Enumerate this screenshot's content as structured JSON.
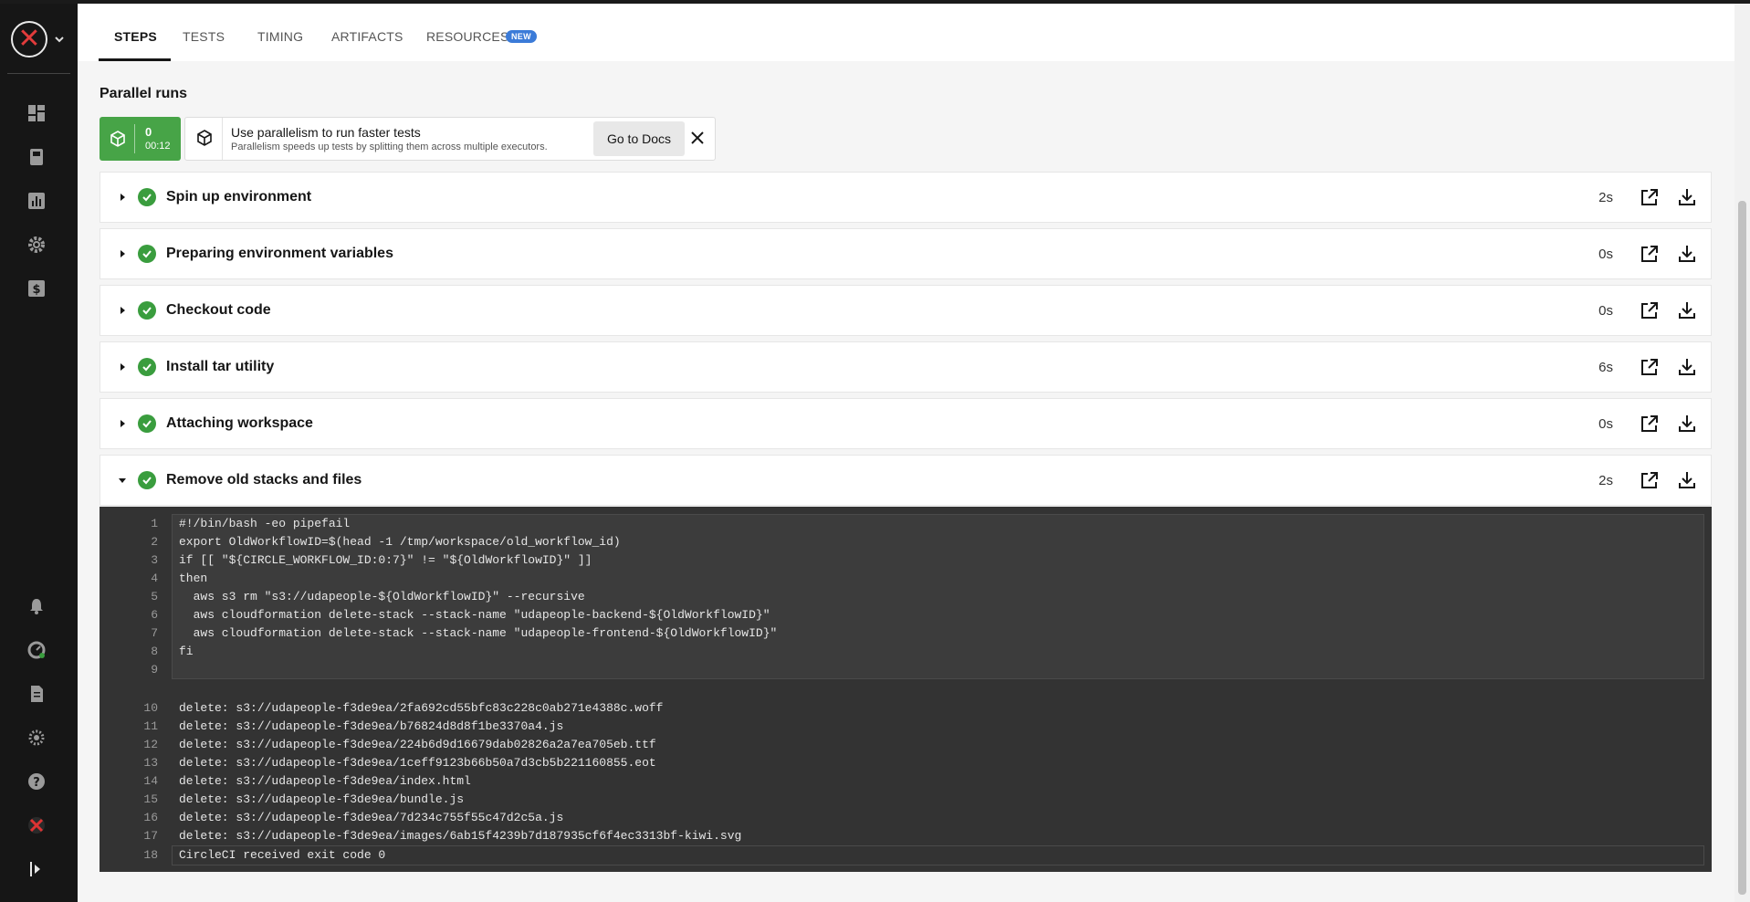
{
  "tabs": [
    {
      "label": "STEPS",
      "active": true
    },
    {
      "label": "TESTS",
      "active": false
    },
    {
      "label": "TIMING",
      "active": false
    },
    {
      "label": "ARTIFACTS",
      "active": false
    },
    {
      "label": "RESOURCES",
      "active": false
    }
  ],
  "resources_badge": "NEW",
  "parallel": {
    "title": "Parallel runs",
    "run_index": "0",
    "run_time": "00:12",
    "hint_title": "Use parallelism to run faster tests",
    "hint_subtitle": "Parallelism speeds up tests by splitting them across multiple executors.",
    "docs_button": "Go to Docs"
  },
  "steps": [
    {
      "name": "Spin up environment",
      "duration": "2s",
      "status": "success",
      "expanded": false
    },
    {
      "name": "Preparing environment variables",
      "duration": "0s",
      "status": "success",
      "expanded": false
    },
    {
      "name": "Checkout code",
      "duration": "0s",
      "status": "success",
      "expanded": false
    },
    {
      "name": "Install tar utility",
      "duration": "6s",
      "status": "success",
      "expanded": false
    },
    {
      "name": "Attaching workspace",
      "duration": "0s",
      "status": "success",
      "expanded": false
    },
    {
      "name": "Remove old stacks and files",
      "duration": "2s",
      "status": "success",
      "expanded": true
    }
  ],
  "terminal": {
    "command_lines": [
      {
        "n": "1",
        "text": "#!/bin/bash -eo pipefail"
      },
      {
        "n": "2",
        "text": "export OldWorkflowID=$(head -1 /tmp/workspace/old_workflow_id)"
      },
      {
        "n": "3",
        "text": "if [[ \"${CIRCLE_WORKFLOW_ID:0:7}\" != \"${OldWorkflowID}\" ]]"
      },
      {
        "n": "4",
        "text": "then"
      },
      {
        "n": "5",
        "text": "  aws s3 rm \"s3://udapeople-${OldWorkflowID}\" --recursive"
      },
      {
        "n": "6",
        "text": "  aws cloudformation delete-stack --stack-name \"udapeople-backend-${OldWorkflowID}\""
      },
      {
        "n": "7",
        "text": "  aws cloudformation delete-stack --stack-name \"udapeople-frontend-${OldWorkflowID}\""
      },
      {
        "n": "8",
        "text": "fi"
      },
      {
        "n": "9",
        "text": ""
      }
    ],
    "output_lines": [
      {
        "n": "10",
        "text": "delete: s3://udapeople-f3de9ea/2fa692cd55bfc83c228c0ab271e4388c.woff"
      },
      {
        "n": "11",
        "text": "delete: s3://udapeople-f3de9ea/b76824d8d8f1be3370a4.js"
      },
      {
        "n": "12",
        "text": "delete: s3://udapeople-f3de9ea/224b6d9d16679dab02826a2a7ea705eb.ttf"
      },
      {
        "n": "13",
        "text": "delete: s3://udapeople-f3de9ea/1ceff9123b66b50a7d3cb5b221160855.eot"
      },
      {
        "n": "14",
        "text": "delete: s3://udapeople-f3de9ea/index.html"
      },
      {
        "n": "15",
        "text": "delete: s3://udapeople-f3de9ea/bundle.js"
      },
      {
        "n": "16",
        "text": "delete: s3://udapeople-f3de9ea/7d234c755f55c47d2c5a.js"
      },
      {
        "n": "17",
        "text": "delete: s3://udapeople-f3de9ea/images/6ab15f4239b7d187935cf6f4ec3313bf-kiwi.svg"
      }
    ],
    "exit_line": {
      "n": "18",
      "text": "CircleCI received exit code 0"
    }
  },
  "sidebar": {
    "top_icons": [
      "dashboard-icon",
      "projects-icon",
      "insights-icon",
      "settings-icon",
      "plan-icon"
    ],
    "bottom_icons": [
      "notifications-icon",
      "status-icon",
      "docs-icon",
      "circleci-gear-icon",
      "help-icon",
      "user-avatar-icon",
      "expand-sidebar-icon"
    ]
  },
  "colors": {
    "success": "#3a9d3e",
    "parallel_badge": "#47a447",
    "terminal_bg": "#333333",
    "sidebar_bg": "#161616",
    "new_badge": "#3b7bd8"
  }
}
